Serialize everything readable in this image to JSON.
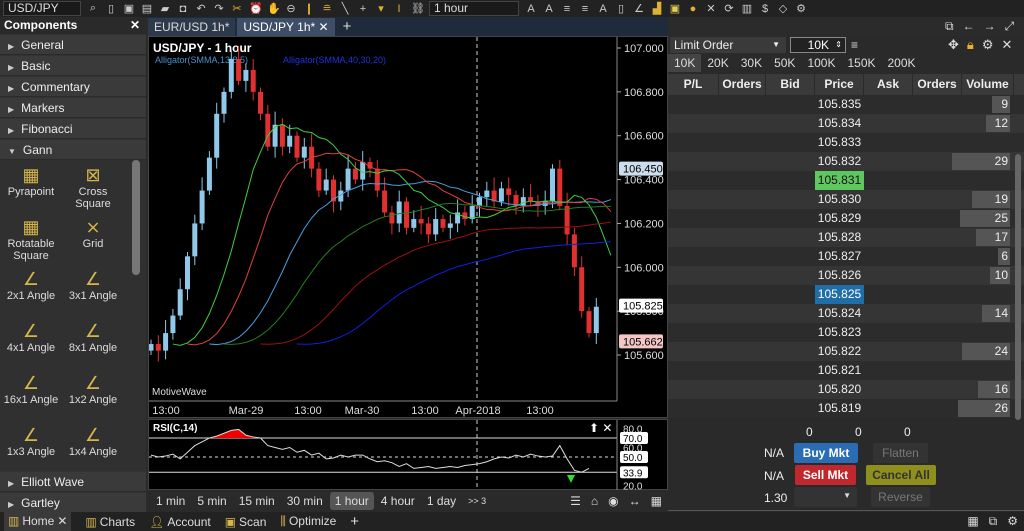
{
  "toolbar": {
    "symbol": "USD/JPY",
    "timeframe": "1 hour"
  },
  "components": {
    "title": "Components",
    "categories_top": [
      "General",
      "Basic",
      "Commentary",
      "Markers",
      "Fibonacci",
      "Gann"
    ],
    "gann_tools": [
      {
        "label": "Pyrapoint",
        "icon": "grid-box"
      },
      {
        "label": "Cross Square",
        "icon": "cross-grid"
      },
      {
        "label": "Rotatable Square",
        "icon": "grid-box"
      },
      {
        "label": "Grid",
        "icon": "x-grid"
      },
      {
        "label": "2x1 Angle",
        "icon": "angle"
      },
      {
        "label": "3x1 Angle",
        "icon": "angle"
      },
      {
        "label": "4x1 Angle",
        "icon": "angle"
      },
      {
        "label": "8x1 Angle",
        "icon": "angle"
      },
      {
        "label": "16x1 Angle",
        "icon": "angle"
      },
      {
        "label": "1x2 Angle",
        "icon": "angle"
      },
      {
        "label": "1x3 Angle",
        "icon": "angle"
      },
      {
        "label": "1x4 Angle",
        "icon": "angle"
      }
    ],
    "categories_bottom": [
      "Elliott Wave",
      "Gartley"
    ]
  },
  "chart_tabs": [
    "EUR/USD 1h*",
    "USD/JPY 1h*"
  ],
  "chart": {
    "title": "USD/JPY - 1 hour",
    "study1": "Alligator(SMMA,13,8,5)",
    "study2": "Alligator(SMMA,40,30,20)",
    "watermark": "MotiveWave",
    "price_ticks": [
      "107.000",
      "106.800",
      "106.600",
      "106.400",
      "106.200",
      "106.000",
      "105.800",
      "105.600"
    ],
    "price_markers": [
      "106.450",
      "105.825",
      "105.662"
    ],
    "time_ticks": [
      "13:00",
      "Mar-29",
      "13:00",
      "Mar-30",
      "13:00",
      "Apr-2018",
      "13:00"
    ]
  },
  "chart_data": {
    "type": "candlestick",
    "ylim": [
      105.55,
      107.05
    ],
    "closes": [
      105.65,
      105.62,
      105.7,
      105.78,
      105.9,
      106.05,
      106.2,
      106.35,
      106.5,
      106.7,
      106.8,
      106.95,
      106.85,
      106.9,
      106.8,
      106.7,
      106.55,
      106.65,
      106.55,
      106.6,
      106.5,
      106.55,
      106.45,
      106.35,
      106.4,
      106.3,
      106.35,
      106.45,
      106.4,
      106.48,
      106.45,
      106.35,
      106.25,
      106.2,
      106.3,
      106.18,
      106.22,
      106.2,
      106.15,
      106.22,
      106.18,
      106.2,
      106.25,
      106.22,
      106.28,
      106.32,
      106.35,
      106.3,
      106.36,
      106.33,
      106.28,
      106.32,
      106.3,
      106.28,
      106.3,
      106.45,
      106.28,
      106.15,
      106.0,
      105.8,
      105.7,
      105.82
    ],
    "rsi": [
      52,
      50,
      51,
      53,
      48,
      55,
      62,
      66,
      70,
      72,
      75,
      78,
      79,
      73,
      71,
      70,
      62,
      60,
      58,
      60,
      55,
      57,
      52,
      54,
      48,
      49,
      52,
      50,
      52,
      52,
      48,
      45,
      46,
      44,
      40,
      43,
      38,
      39,
      40,
      38,
      39,
      40,
      39,
      41,
      42,
      43,
      45,
      48,
      50,
      49,
      52,
      50,
      53,
      51,
      50,
      51,
      62,
      48,
      36,
      34,
      38
    ]
  },
  "rsi": {
    "title": "RSI(C,14)",
    "ticks": [
      "80.0",
      "70.0",
      "60.0",
      "50.0",
      "33.9",
      "20.0"
    ]
  },
  "timeframes": [
    "1 min",
    "5 min",
    "15 min",
    "30 min",
    "1 hour",
    "4 hour",
    "1 day"
  ],
  "timeframes_more": ">> 3",
  "order": {
    "type": "Limit Order",
    "qty": "10K",
    "qty_presets": [
      "10K",
      "20K",
      "30K",
      "50K",
      "100K",
      "150K",
      "200K"
    ],
    "columns": [
      "P/L",
      "Orders",
      "Bid",
      "Price",
      "Ask",
      "Orders",
      "Volume"
    ],
    "rows": [
      {
        "price": "105.835",
        "volume": "9"
      },
      {
        "price": "105.834",
        "volume": "12"
      },
      {
        "price": "105.833",
        "volume": ""
      },
      {
        "price": "105.832",
        "volume": "29"
      },
      {
        "price": "105.831",
        "volume": "",
        "hl": "ask"
      },
      {
        "price": "105.830",
        "volume": "19"
      },
      {
        "price": "105.829",
        "volume": "25"
      },
      {
        "price": "105.828",
        "volume": "17"
      },
      {
        "price": "105.827",
        "volume": "6"
      },
      {
        "price": "105.826",
        "volume": "10"
      },
      {
        "price": "105.825",
        "volume": "",
        "hl": "bid"
      },
      {
        "price": "105.824",
        "volume": "14"
      },
      {
        "price": "105.823",
        "volume": ""
      },
      {
        "price": "105.822",
        "volume": "24"
      },
      {
        "price": "105.821",
        "volume": ""
      },
      {
        "price": "105.820",
        "volume": "16"
      },
      {
        "price": "105.819",
        "volume": "26"
      }
    ],
    "totals": [
      "0",
      "0",
      "0"
    ],
    "na1": "N/A",
    "na2": "N/A",
    "ratio": "1.30",
    "buy": "Buy Mkt",
    "sell": "Sell Mkt",
    "flatten": "Flatten",
    "cancel_all": "Cancel All",
    "reverse": "Reverse"
  },
  "colors": {
    "buy": "#2a6db5",
    "sell": "#c0282d",
    "cancel": "#8f8f1e",
    "ask_hl": "#5ec85e",
    "bid_hl": "#1f6ea8",
    "up": "#8fc8e8",
    "down": "#e03030"
  },
  "bottom_tabs": [
    "Home",
    "Charts",
    "Account",
    "Scan",
    "Optimize"
  ]
}
